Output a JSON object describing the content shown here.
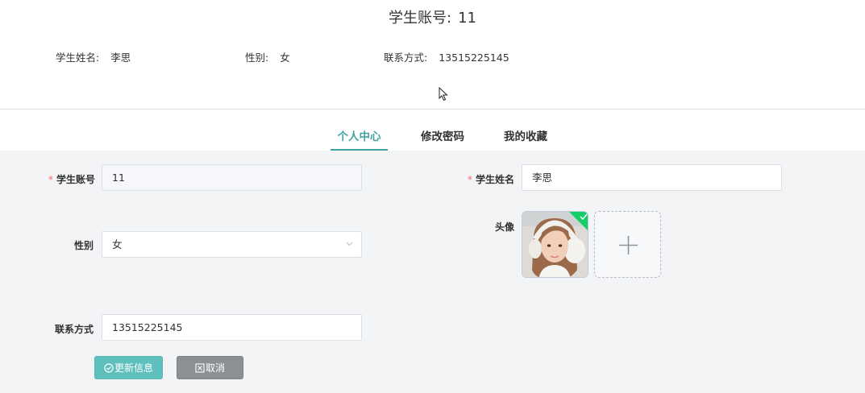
{
  "header": {
    "account_label": "学生账号:",
    "account_value": "11",
    "name_label": "学生姓名:",
    "name_value": "李思",
    "gender_label": "性别:",
    "gender_value": "女",
    "phone_label": "联系方式:",
    "phone_value": "13515225145"
  },
  "tabs": [
    {
      "label": "个人中心",
      "active": true
    },
    {
      "label": "修改密码",
      "active": false
    },
    {
      "label": "我的收藏",
      "active": false
    }
  ],
  "form": {
    "required_mark": "*",
    "account": {
      "label": "学生账号",
      "value": "11"
    },
    "name": {
      "label": "学生姓名",
      "value": "李思"
    },
    "gender": {
      "label": "性别",
      "value": "女"
    },
    "avatar": {
      "label": "头像"
    },
    "phone": {
      "label": "联系方式",
      "value": "13515225145"
    }
  },
  "buttons": {
    "update_label": "更新信息",
    "cancel_label": "取消"
  },
  "icons": {
    "avatar_uploaded": "check-icon",
    "upload_new": "plus-icon",
    "select_arrow": "chevron-down-icon",
    "update": "circle-check-icon",
    "cancel": "close-box-icon",
    "cursor": "mouse-pointer-icon"
  },
  "colors": {
    "accent": "#3ea3a1",
    "update_button": "#5ebfbd",
    "cancel_button": "#8c8f94",
    "required": "#f56c6c",
    "panel_background": "#f3f4f5"
  }
}
